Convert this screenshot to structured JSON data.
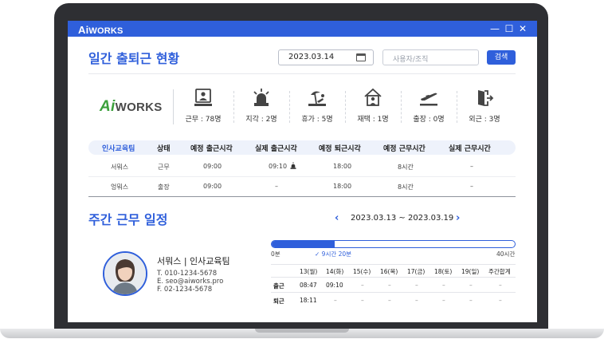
{
  "window": {
    "brand": "WORKS",
    "brand_prefix": "Ai",
    "minimize": "—",
    "maximize": "☐",
    "close": "✕"
  },
  "header": {
    "title": "일간 출퇴근 현황",
    "date_value": "2023.03.14",
    "search_placeholder": "사용자/조직",
    "search_button": "검색"
  },
  "logo": {
    "prefix": "Ai",
    "text": "WORKS"
  },
  "stats": [
    {
      "icon": "desk-worker-icon",
      "label": "근무 : 78명"
    },
    {
      "icon": "siren-icon",
      "label": "지각 : 2명"
    },
    {
      "icon": "beach-vacation-icon",
      "label": "휴가 : 5명"
    },
    {
      "icon": "home-work-icon",
      "label": "재택 : 1명"
    },
    {
      "icon": "airplane-departure-icon",
      "label": "출장 : 0명"
    },
    {
      "icon": "exit-door-icon",
      "label": "외근 : 3명"
    }
  ],
  "table": {
    "columns": [
      "인사교육팀",
      "상태",
      "예정 출근시각",
      "실제 출근시각",
      "예정 퇴근시각",
      "예정 근무시간",
      "실제 근무시간"
    ],
    "rows": [
      [
        "서뭐스",
        "근무",
        "09:00",
        "09:10",
        "18:00",
        "8시간",
        "–"
      ],
      [
        "엉뭐스",
        "출장",
        "09:00",
        "–",
        "18:00",
        "8시간",
        "–"
      ]
    ]
  },
  "weekly": {
    "title": "주간 근무 일정",
    "prev": "‹",
    "next": "›",
    "range": "2023.03.13 ~ 2023.03.19",
    "profile": {
      "name": "서뭐스 | 인사교육팀",
      "tel": "T. 010-1234-5678",
      "email": "E. seo@aiworks.pro",
      "fax": "F. 02-1234-5678"
    },
    "progress": {
      "min_label": "0분",
      "current_label": "9시간 20분",
      "max_label": "40시간",
      "fraction": 0.26
    },
    "columns": [
      "",
      "13(월)",
      "14(화)",
      "15(수)",
      "16(목)",
      "17(금)",
      "18(토)",
      "19(일)",
      "주간합계"
    ],
    "rows": [
      {
        "label": "출근",
        "values": [
          "08:47",
          "09:10",
          "–",
          "–",
          "–",
          "–",
          "–",
          "–"
        ]
      },
      {
        "label": "퇴근",
        "values": [
          "18:11",
          "–",
          "–",
          "–",
          "–",
          "–",
          "–",
          "–"
        ]
      }
    ]
  },
  "colors": {
    "accent": "#2f5fdb",
    "logo_green": "#3ba03b"
  }
}
